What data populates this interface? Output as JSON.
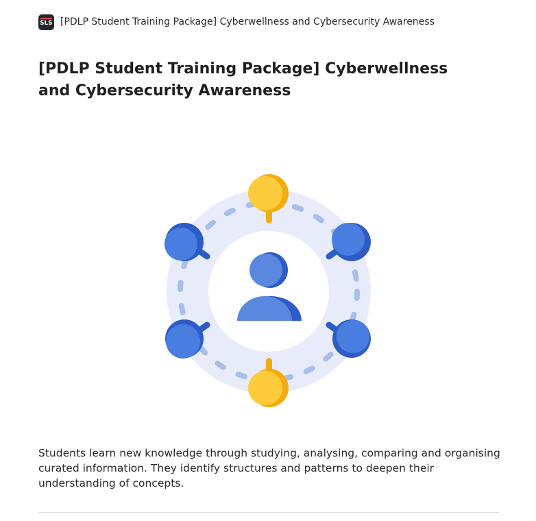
{
  "header": {
    "logo_text": "SLS",
    "title": "[PDLP Student Training Package] Cyberwellness and Cybersecurity Awareness"
  },
  "main": {
    "title": "[PDLP Student Training Package] Cyberwellness and Cybersecurity Awareness",
    "illustration": {
      "center_icon": "user-icon",
      "node_icons": [
        "magnifier-icon",
        "magnifier-icon",
        "magnifier-icon",
        "magnifier-icon",
        "pin-icon",
        "pin-icon"
      ],
      "colors": {
        "ring": "#e8ecfa",
        "dashes": "#a9bee8",
        "blue_node": "#4a7de0",
        "blue_node_shadow": "#2d5cc9",
        "yellow_node": "#fdcb3b",
        "yellow_node_shadow": "#f3ac0f"
      }
    },
    "description": "Students learn new knowledge through studying, analysing, comparing and organising curated information. They identify structures and patterns to deepen their understanding of concepts."
  }
}
